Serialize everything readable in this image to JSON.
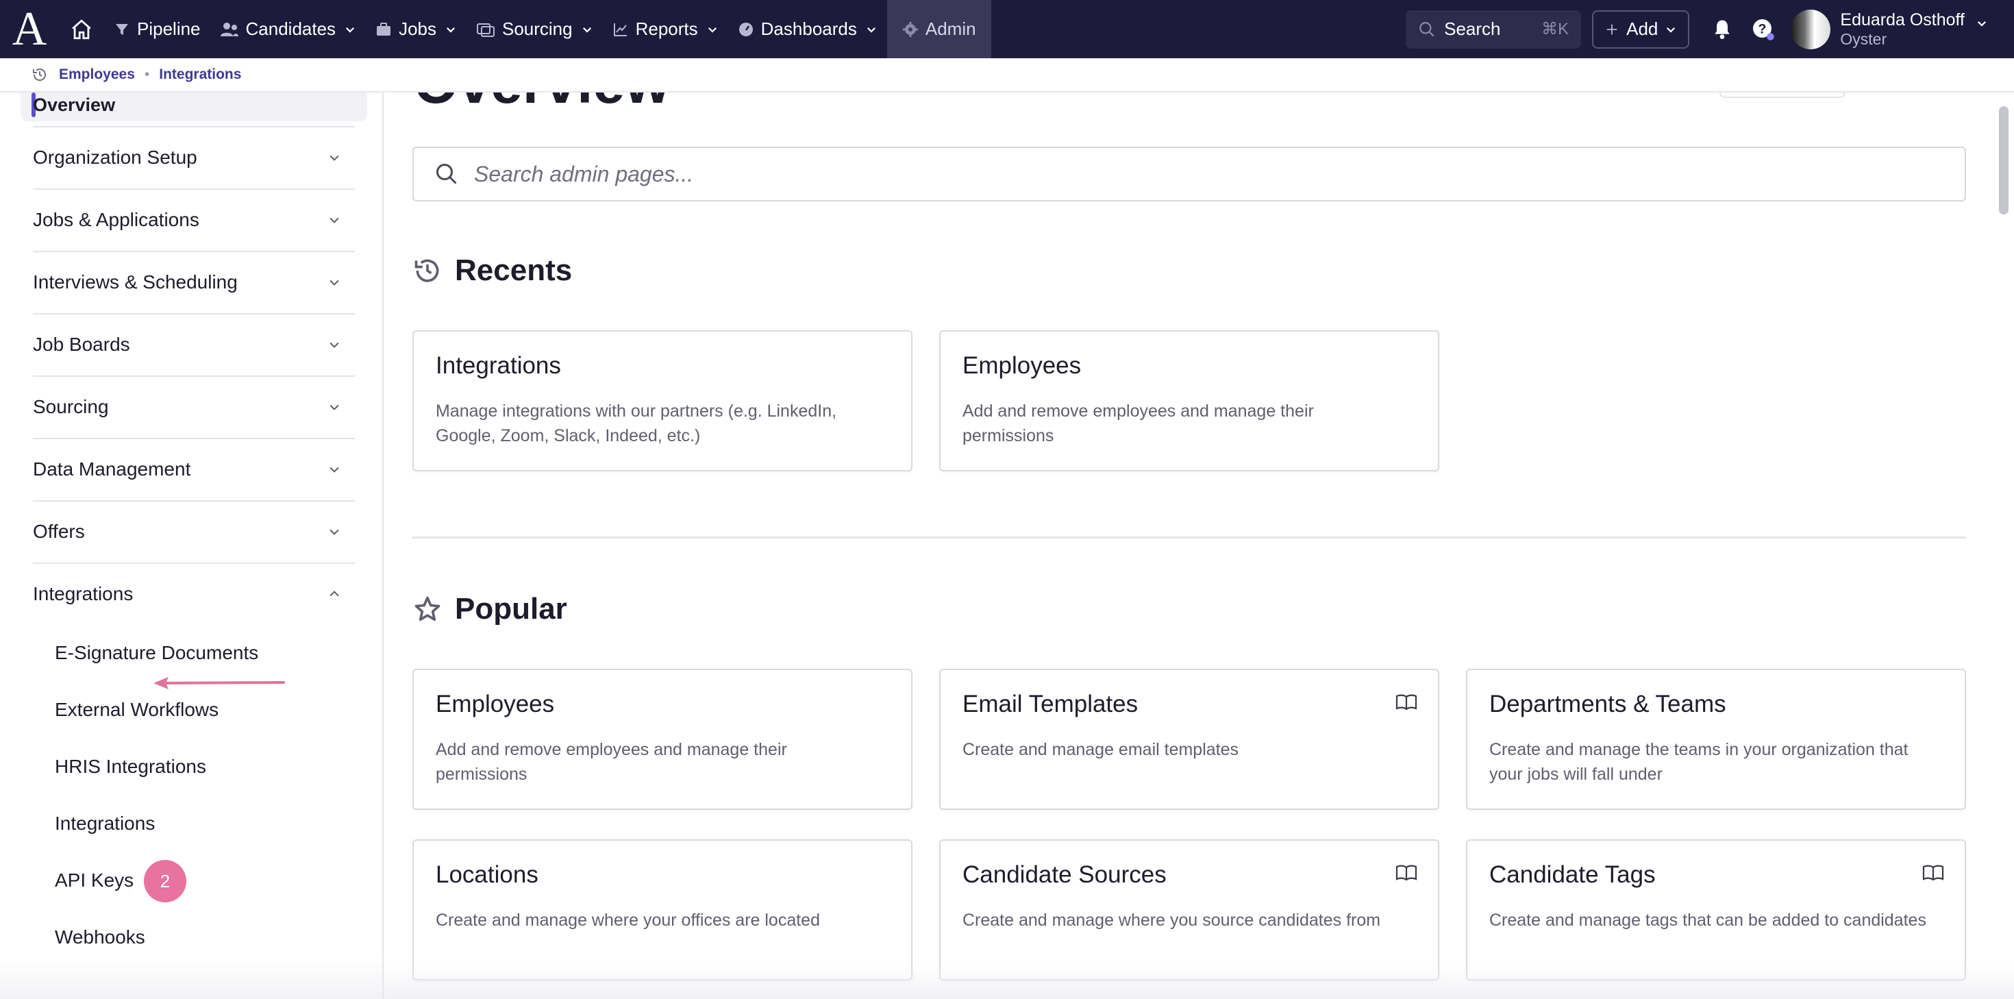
{
  "nav": {
    "logo": "A",
    "items": [
      {
        "label": "Pipeline"
      },
      {
        "label": "Candidates"
      },
      {
        "label": "Jobs"
      },
      {
        "label": "Sourcing"
      },
      {
        "label": "Reports"
      },
      {
        "label": "Dashboards"
      },
      {
        "label": "Admin"
      }
    ],
    "search_label": "Search",
    "search_shortcut": "⌘K",
    "add_label": "Add",
    "user_name": "Eduarda Osthoff",
    "user_org": "Oyster"
  },
  "breadcrumb": [
    "Employees",
    "Integrations"
  ],
  "sidebar": {
    "active": "Overview",
    "groups": [
      "Organization Setup",
      "Jobs & Applications",
      "Interviews & Scheduling",
      "Job Boards",
      "Sourcing",
      "Data Management",
      "Offers",
      "Integrations"
    ],
    "integrations_children": [
      "E-Signature Documents",
      "External Workflows",
      "HRIS Integrations",
      "Integrations",
      "API Keys",
      "Webhooks"
    ],
    "badge_count": "2"
  },
  "main": {
    "title": "Overview",
    "search_placeholder": "Search admin pages...",
    "recents_title": "Recents",
    "recents": [
      {
        "title": "Integrations",
        "desc": "Manage integrations with our partners (e.g. LinkedIn, Google, Zoom, Slack, Indeed, etc.)"
      },
      {
        "title": "Employees",
        "desc": "Add and remove employees and manage their permissions"
      }
    ],
    "popular_title": "Popular",
    "popular": [
      {
        "title": "Employees",
        "desc": "Add and remove employees and manage their permissions"
      },
      {
        "title": "Email Templates",
        "desc": "Create and manage email templates"
      },
      {
        "title": "Departments & Teams",
        "desc": "Create and manage the teams in your organization that your jobs will fall under"
      },
      {
        "title": "Locations",
        "desc": "Create and manage where your offices are located"
      },
      {
        "title": "Candidate Sources",
        "desc": "Create and manage where you source candidates from"
      },
      {
        "title": "Candidate Tags",
        "desc": "Create and manage tags that can be added to candidates"
      }
    ]
  },
  "colors": {
    "nav_bg": "#1d1b3c",
    "accent": "#3d3994",
    "badge": "#e7739e"
  }
}
